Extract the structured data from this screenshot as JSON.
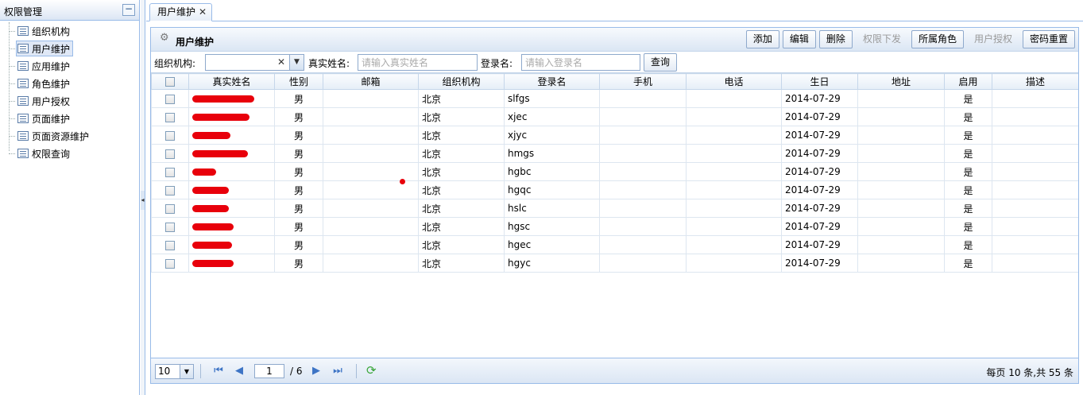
{
  "sidebar": {
    "title": "权限管理",
    "collapse_symbol": "−",
    "items": [
      {
        "label": "组织机构",
        "icon": "page-icon"
      },
      {
        "label": "用户维护",
        "icon": "page-icon",
        "selected": true
      },
      {
        "label": "应用维护",
        "icon": "page-icon"
      },
      {
        "label": "角色维护",
        "icon": "page-icon"
      },
      {
        "label": "用户授权",
        "icon": "page-icon"
      },
      {
        "label": "页面维护",
        "icon": "page-icon"
      },
      {
        "label": "页面资源维护",
        "icon": "page-icon"
      },
      {
        "label": "权限查询",
        "icon": "page-icon"
      }
    ]
  },
  "tab": {
    "label": "用户维护",
    "close": "✕"
  },
  "panel": {
    "title": "用户维护",
    "toolbar": [
      {
        "label": "添加",
        "enabled": true
      },
      {
        "label": "编辑",
        "enabled": true
      },
      {
        "label": "删除",
        "enabled": true
      },
      {
        "label": "权限下发",
        "enabled": false
      },
      {
        "label": "所属角色",
        "enabled": true
      },
      {
        "label": "用户授权",
        "enabled": false
      },
      {
        "label": "密码重置",
        "enabled": true
      }
    ]
  },
  "search": {
    "org_label": "组织机构:",
    "org_value": "",
    "org_clear": "✕",
    "name_label": "真实姓名:",
    "name_placeholder": "请输入真实姓名",
    "login_label": "登录名:",
    "login_placeholder": "请输入登录名",
    "query_button": "查询"
  },
  "grid": {
    "columns": [
      "真实姓名",
      "性别",
      "邮箱",
      "组织机构",
      "登录名",
      "手机",
      "电话",
      "生日",
      "地址",
      "启用",
      "描述"
    ],
    "rows": [
      {
        "name": "",
        "gender": "男",
        "email": "",
        "org": "北京",
        "login": "slfgs",
        "mobile": "",
        "phone": "",
        "birthday": "2014-07-29",
        "address": "",
        "enabled": "是",
        "desc": ""
      },
      {
        "name": "",
        "gender": "男",
        "email": "",
        "org": "北京",
        "login": "xjec",
        "mobile": "",
        "phone": "",
        "birthday": "2014-07-29",
        "address": "",
        "enabled": "是",
        "desc": ""
      },
      {
        "name": "",
        "gender": "男",
        "email": "",
        "org": "北京",
        "login": "xjyc",
        "mobile": "",
        "phone": "",
        "birthday": "2014-07-29",
        "address": "",
        "enabled": "是",
        "desc": ""
      },
      {
        "name": "",
        "gender": "男",
        "email": "",
        "org": "北京",
        "login": "hmgs",
        "mobile": "",
        "phone": "",
        "birthday": "2014-07-29",
        "address": "",
        "enabled": "是",
        "desc": ""
      },
      {
        "name": "",
        "gender": "男",
        "email": "",
        "org": "北京",
        "login": "hgbc",
        "mobile": "",
        "phone": "",
        "birthday": "2014-07-29",
        "address": "",
        "enabled": "是",
        "desc": ""
      },
      {
        "name": "",
        "gender": "男",
        "email": "",
        "org": "北京",
        "login": "hgqc",
        "mobile": "",
        "phone": "",
        "birthday": "2014-07-29",
        "address": "",
        "enabled": "是",
        "desc": ""
      },
      {
        "name": "",
        "gender": "男",
        "email": "",
        "org": "北京",
        "login": "hslc",
        "mobile": "",
        "phone": "",
        "birthday": "2014-07-29",
        "address": "",
        "enabled": "是",
        "desc": ""
      },
      {
        "name": "",
        "gender": "男",
        "email": "",
        "org": "北京",
        "login": "hgsc",
        "mobile": "",
        "phone": "",
        "birthday": "2014-07-29",
        "address": "",
        "enabled": "是",
        "desc": ""
      },
      {
        "name": "",
        "gender": "男",
        "email": "",
        "org": "北京",
        "login": "hgec",
        "mobile": "",
        "phone": "",
        "birthday": "2014-07-29",
        "address": "",
        "enabled": "是",
        "desc": ""
      },
      {
        "name": "",
        "gender": "男",
        "email": "",
        "org": "北京",
        "login": "hgyc",
        "mobile": "",
        "phone": "",
        "birthday": "2014-07-29",
        "address": "",
        "enabled": "是",
        "desc": ""
      }
    ]
  },
  "pager": {
    "page_size": "10",
    "current_page": "1",
    "total_pages_text": "/ 6",
    "info": "每页 10 条,共 55 条"
  },
  "colors": {
    "accent": "#99bbe8",
    "redaction": "#e8000b"
  }
}
